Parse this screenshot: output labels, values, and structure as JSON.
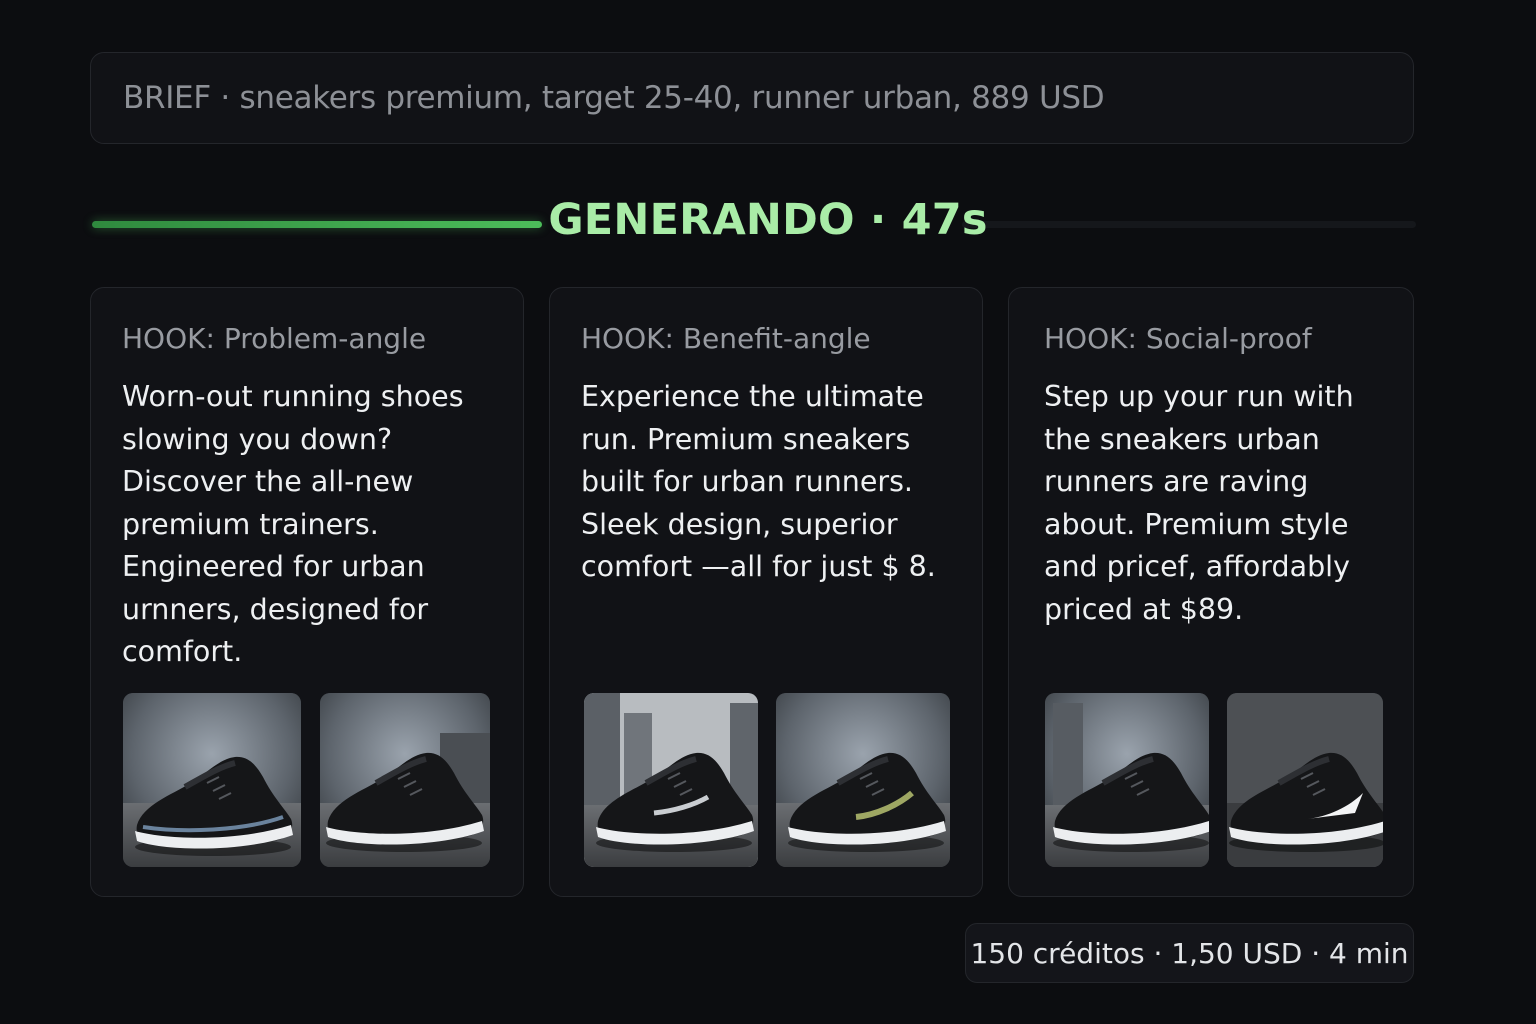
{
  "brief": {
    "text": "BRIEF · sneakers premium, target 25-40, runner urban, 889 USD"
  },
  "progress": {
    "status": "GENERANDO · 47s",
    "fraction": 0.34,
    "accent": "#4cbd5a"
  },
  "cards": [
    {
      "hook": "HOOK: Problem-angle",
      "copy": "Worn-out running shoes slowing you down? Discover the all-new premium trainers. Engineered for urban urnners, designed for comfort.",
      "images": [
        "sneaker-image",
        "sneaker-image"
      ]
    },
    {
      "hook": "HOOK: Benefit-angle",
      "copy": "Experience the ultimate run. Premium sneakers built for urban runners. Sleek design, superior comfort —all for just $ 8.",
      "images": [
        "sneaker-image",
        "sneaker-image"
      ]
    },
    {
      "hook": "HOOK: Social-proof",
      "copy": "Step up your run with the sneakers urban runners are raving about. Premium style and pricef, affordably priced at $89.",
      "images": [
        "sneaker-image",
        "sneaker-image"
      ]
    }
  ],
  "footer": {
    "cost": "150 créditos · 1,50 USD · 4 min"
  }
}
